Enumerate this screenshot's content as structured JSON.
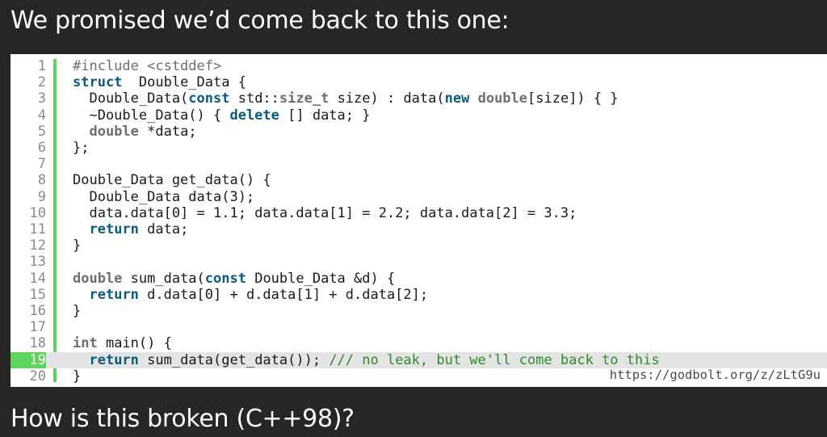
{
  "slide": {
    "title": "We promised we’d come back to this one:",
    "question": "How is this broken (C++98)?"
  },
  "code": {
    "lines": [
      {
        "n": "1",
        "t": [
          [
            "pp",
            "#include <cstddef>"
          ]
        ]
      },
      {
        "n": "2",
        "t": [
          [
            "kw",
            "struct"
          ],
          [
            "",
            "  Double_Data {"
          ]
        ]
      },
      {
        "n": "3",
        "t": [
          [
            "",
            "  Double_Data("
          ],
          [
            "kw",
            "const"
          ],
          [
            "",
            " std::"
          ],
          [
            "ty",
            "size_t"
          ],
          [
            "",
            " size) : data("
          ],
          [
            "kw",
            "new"
          ],
          [
            "",
            " "
          ],
          [
            "ty",
            "double"
          ],
          [
            "",
            "[size]) { }"
          ]
        ]
      },
      {
        "n": "4",
        "t": [
          [
            "",
            "  ~Double_Data() { "
          ],
          [
            "kw",
            "delete"
          ],
          [
            "",
            " [] data; }"
          ]
        ]
      },
      {
        "n": "5",
        "t": [
          [
            "",
            "  "
          ],
          [
            "ty",
            "double"
          ],
          [
            "",
            " *data;"
          ]
        ]
      },
      {
        "n": "6",
        "t": [
          [
            "",
            "};"
          ]
        ]
      },
      {
        "n": "7",
        "t": []
      },
      {
        "n": "8",
        "t": [
          [
            "",
            "Double_Data get_data() {"
          ]
        ]
      },
      {
        "n": "9",
        "t": [
          [
            "",
            "  Double_Data data(3);"
          ]
        ]
      },
      {
        "n": "10",
        "t": [
          [
            "",
            "  data.data[0] = 1.1; data.data[1] = 2.2; data.data[2] = 3.3;"
          ]
        ]
      },
      {
        "n": "11",
        "t": [
          [
            "",
            "  "
          ],
          [
            "kw",
            "return"
          ],
          [
            "",
            " data;"
          ]
        ]
      },
      {
        "n": "12",
        "t": [
          [
            "",
            "}"
          ]
        ]
      },
      {
        "n": "13",
        "t": []
      },
      {
        "n": "14",
        "t": [
          [
            "ty",
            "double"
          ],
          [
            "",
            " sum_data("
          ],
          [
            "kw",
            "const"
          ],
          [
            "",
            " Double_Data &d) {"
          ]
        ]
      },
      {
        "n": "15",
        "t": [
          [
            "",
            "  "
          ],
          [
            "kw",
            "return"
          ],
          [
            "",
            " d.data[0] + d.data[1] + d.data[2];"
          ]
        ]
      },
      {
        "n": "16",
        "t": [
          [
            "",
            "}"
          ]
        ]
      },
      {
        "n": "17",
        "t": []
      },
      {
        "n": "18",
        "t": [
          [
            "ty",
            "int"
          ],
          [
            "",
            " main() {"
          ]
        ]
      },
      {
        "n": "19",
        "t": [
          [
            "",
            "  "
          ],
          [
            "kw",
            "return"
          ],
          [
            "",
            " sum_data(get_data()); "
          ],
          [
            "cm",
            "/// no leak, but we'll come back to this"
          ]
        ],
        "hl": true
      },
      {
        "n": "20",
        "t": [
          [
            "",
            "}"
          ]
        ]
      }
    ],
    "url": "https://godbolt.org/z/zLtG9u"
  },
  "colors": {
    "background": "#262626",
    "editor": "#ffffff",
    "gutter_accent": "#5cd65c",
    "keyword": "#0b5b7e",
    "type": "#6e6e6e",
    "comment": "#2e8b2e"
  }
}
